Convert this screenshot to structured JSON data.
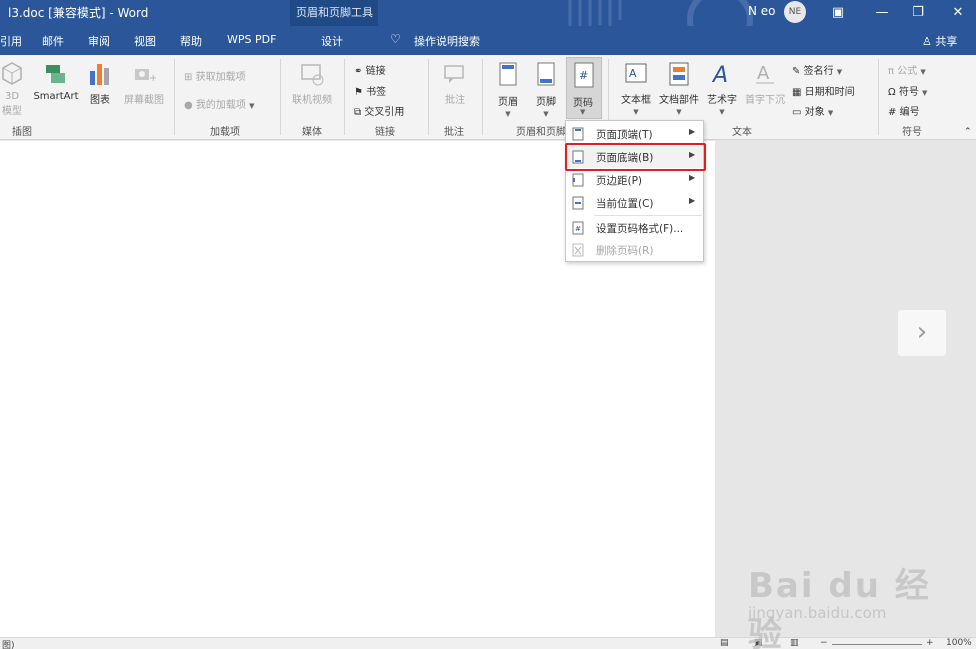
{
  "titlebar": {
    "doc_title": "l3.doc [兼容模式]  -  Word",
    "tools_title": "页眉和页脚工具",
    "user_name": "N eo",
    "avatar_initials": "NE",
    "ribbon_display_icon": "ribbon-display-options-icon",
    "minimize_glyph": "—",
    "restore_glyph": "❐"
  },
  "tabs": {
    "items": [
      "引用",
      "邮件",
      "审阅",
      "视图",
      "帮助",
      "WPS PDF",
      "设计"
    ],
    "active": "设计",
    "search_label": "操作说明搜索",
    "share_label": "共享"
  },
  "ribbon": {
    "groups": {
      "illustrations": "插图",
      "addins": "加载项",
      "media": "媒体",
      "links": "链接",
      "comments": "批注",
      "header_footer": "页眉和页脚",
      "text": "文本",
      "symbols": "符号"
    },
    "buttons": {
      "model3d": "3D\n模型",
      "smartart": "SmartArt",
      "chart": "图表",
      "screenshot": "屏幕截图",
      "get_addins": "获取加载项",
      "my_addins": "我的加载项",
      "online_video": "联机视频",
      "link": "链接",
      "bookmark": "书签",
      "cross_ref": "交叉引用",
      "comment": "批注",
      "header": "页眉",
      "footer": "页脚",
      "page_number": "页码",
      "text_box": "文本框",
      "quick_parts": "文档部件",
      "wordart": "艺术字",
      "drop_cap": "首字下沉",
      "signature": "签名行",
      "datetime": "日期和时间",
      "object": "对象",
      "equation": "公式",
      "symbol": "符号",
      "number": "编号"
    }
  },
  "menu": {
    "items": [
      {
        "label": "页面顶端(T)",
        "submenu": true,
        "enabled": true
      },
      {
        "label": "页面底端(B)",
        "submenu": true,
        "enabled": true,
        "highlighted": true
      },
      {
        "label": "页边距(P)",
        "submenu": true,
        "enabled": true
      },
      {
        "label": "当前位置(C)",
        "submenu": true,
        "enabled": true
      },
      {
        "label": "设置页码格式(F)...",
        "submenu": false,
        "enabled": true
      },
      {
        "label": "删除页码(R)",
        "submenu": false,
        "enabled": false
      }
    ]
  },
  "statusbar": {
    "left_text": "图)",
    "zoom": "100%"
  },
  "watermark": {
    "brand": "Bai du 经验",
    "url": "jingyan.baidu.com"
  },
  "colors": {
    "title_blue": "#2b579a",
    "tools_blue": "#1f4a86",
    "highlight_red": "#e0201e"
  }
}
